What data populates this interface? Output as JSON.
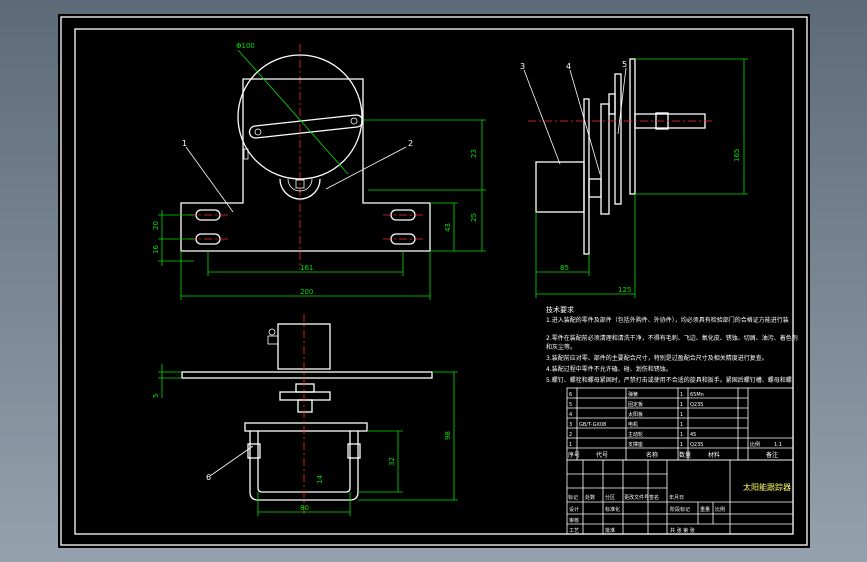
{
  "views": {
    "front": {
      "dims": {
        "total_width": "200",
        "hole_span": "161",
        "right_tall": "23",
        "right_mid": "25",
        "right_low": "43",
        "left_a": "20",
        "left_b": "16",
        "diameter": "Φ100"
      },
      "callouts": [
        "1",
        "2"
      ]
    },
    "side": {
      "dims": {
        "height": "165",
        "depth_a": "85",
        "depth_b": "125"
      },
      "callouts": [
        "3",
        "4",
        "5"
      ]
    },
    "bottom": {
      "dims": {
        "width": "80",
        "h1": "98",
        "h2": "32",
        "h3": "14",
        "left": "5"
      },
      "callouts": [
        "6"
      ]
    }
  },
  "notes": {
    "title": "技术要求",
    "items": [
      "1.进入装配的零件及部件（包括外购件、外协件），均必须具有检验部门的合格证方能进行装",
      "2.零件在装配前必须清理和清洗干净，不得有毛刺、飞边、氧化皮、锈蚀、切屑、油污、着色剂",
      "和灰尘等。",
      "3.装配前应对零、部件的主要配合尺寸，特别是过盈配合尺寸及相关精度进行复查。",
      "4.装配过程中零件不允许磕、碰、划伤和锈蚀。",
      "5.螺钉、螺栓和螺母紧固时，严禁打击或使用不合适的旋具和扳手。紧固后螺钉槽、螺母和螺"
    ]
  },
  "bom": {
    "rows": [
      [
        "6",
        "",
        "弹簧",
        "1",
        "65Mn",
        ""
      ],
      [
        "5",
        "",
        "固定板",
        "1",
        "Q235",
        ""
      ],
      [
        "4",
        "",
        "太阳板",
        "1",
        "",
        ""
      ],
      [
        "3",
        "GB/T-GX08",
        "电机",
        "1",
        "",
        ""
      ],
      [
        "2",
        "",
        "主动轮",
        "1",
        "45",
        ""
      ],
      [
        "1",
        "",
        "支撑座",
        "1",
        "Q235",
        ""
      ]
    ],
    "header": [
      "序号",
      "代号",
      "名称",
      "数量",
      "材料",
      "备注"
    ],
    "scale_label": "比例",
    "scale": "1:1"
  },
  "title_block": {
    "drawing_title": "太阳能跟踪器",
    "labels": [
      "标记",
      "处数",
      "分区",
      "更改文件号",
      "签名",
      "年月日"
    ],
    "roles": [
      "设计",
      "标准化",
      "阶段标记",
      "重量",
      "比例",
      "审核",
      "工艺",
      "批准"
    ],
    "sheet": "共 张 第 张"
  }
}
